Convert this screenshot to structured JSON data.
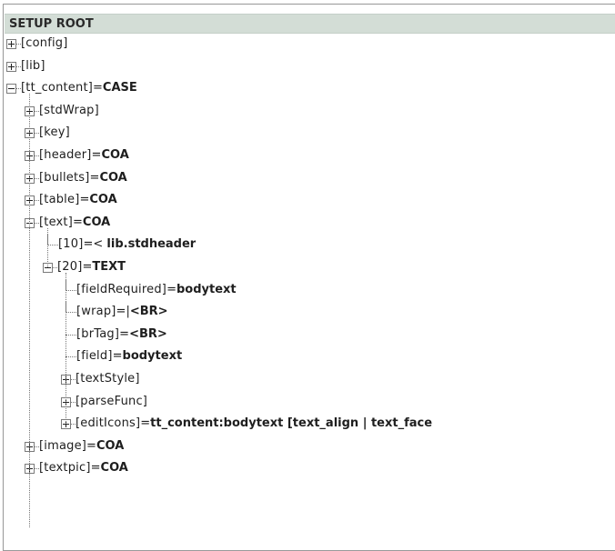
{
  "header": {
    "title": "SETUP ROOT"
  },
  "tree": [
    {
      "key": "[config]",
      "op": "",
      "value": "",
      "toggle": "plus",
      "level": 0
    },
    {
      "key": "[lib]",
      "op": "",
      "value": "",
      "toggle": "plus",
      "level": 0
    },
    {
      "key": "[tt_content]",
      "op": "=",
      "value": "CASE",
      "toggle": "minus",
      "level": 0
    },
    {
      "key": "[stdWrap]",
      "op": "",
      "value": "",
      "toggle": "plus",
      "level": 1
    },
    {
      "key": "[key]",
      "op": "",
      "value": "",
      "toggle": "plus",
      "level": 1
    },
    {
      "key": "[header]",
      "op": "=",
      "value": "COA",
      "toggle": "plus",
      "level": 1
    },
    {
      "key": "[bullets]",
      "op": "=",
      "value": "COA",
      "toggle": "plus",
      "level": 1
    },
    {
      "key": "[table]",
      "op": "=",
      "value": "COA",
      "toggle": "plus",
      "level": 1
    },
    {
      "key": "[text]",
      "op": "=",
      "value": "COA",
      "toggle": "minus",
      "level": 1
    },
    {
      "key": "[10]",
      "op": "=< ",
      "value": "lib.stdheader",
      "toggle": "none",
      "level": 2
    },
    {
      "key": "[20]",
      "op": "=",
      "value": "TEXT",
      "toggle": "minus",
      "level": 2
    },
    {
      "key": "[fieldRequired]",
      "op": "=",
      "value": "bodytext",
      "toggle": "none",
      "level": 3
    },
    {
      "key": "[wrap]",
      "op": "=|",
      "value": "<BR>",
      "toggle": "none",
      "level": 3
    },
    {
      "key": "[brTag]",
      "op": "=",
      "value": "<BR>",
      "toggle": "none",
      "level": 3
    },
    {
      "key": "[field]",
      "op": "=",
      "value": "bodytext",
      "toggle": "none",
      "level": 3
    },
    {
      "key": "[textStyle]",
      "op": "",
      "value": "",
      "toggle": "plus",
      "level": 3
    },
    {
      "key": "[parseFunc]",
      "op": "",
      "value": "",
      "toggle": "plus",
      "level": 3
    },
    {
      "key": "[editIcons]",
      "op": "=",
      "value": "tt_content:bodytext [text_align | text_face",
      "toggle": "plus",
      "level": 3
    },
    {
      "key": "[image]",
      "op": "=",
      "value": "COA",
      "toggle": "plus",
      "level": 1
    },
    {
      "key": "[textpic]",
      "op": "=",
      "value": "COA",
      "toggle": "plus",
      "level": 1
    }
  ]
}
